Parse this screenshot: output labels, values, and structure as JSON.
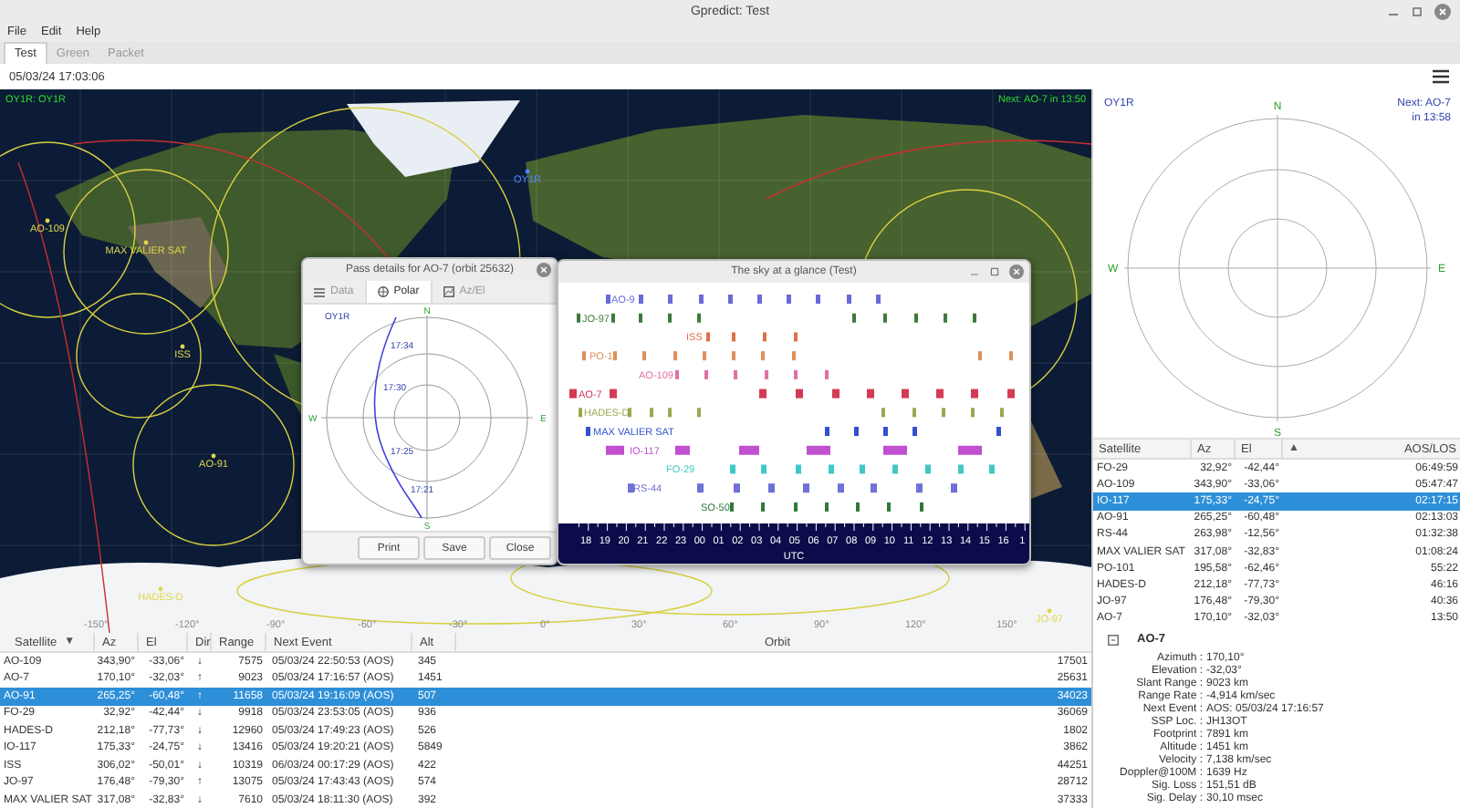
{
  "window": {
    "title": "Gpredict: Test"
  },
  "menu": [
    "File",
    "Edit",
    "Help"
  ],
  "tabs": [
    {
      "label": "Test",
      "selected": true
    },
    {
      "label": "Green",
      "selected": false
    },
    {
      "label": "Packet",
      "selected": false
    }
  ],
  "clock": "05/03/24 17:03:06",
  "map": {
    "qth_label": "OY1R: OY1R",
    "next_event": "Next: AO-7 in 13:50",
    "markers": [
      {
        "name": "OY1R",
        "kind": "station"
      },
      {
        "name": "AO-109",
        "kind": "satellite"
      },
      {
        "name": "MAX VALIER SAT",
        "kind": "satellite"
      },
      {
        "name": "ISS",
        "kind": "satellite"
      },
      {
        "name": "AO-91",
        "kind": "satellite"
      },
      {
        "name": "HADES-D",
        "kind": "satellite"
      },
      {
        "name": "JO-97",
        "kind": "satellite"
      }
    ],
    "longitudes": [
      "-150°",
      "-120°",
      "-90°",
      "-60°",
      "-30°",
      "0°",
      "30°",
      "60°",
      "90°",
      "120°",
      "150°"
    ]
  },
  "pass_dialog": {
    "title": "Pass details for AO-7 (orbit 25632)",
    "tabs": [
      {
        "label": "Data",
        "selected": false
      },
      {
        "label": "Polar",
        "selected": true
      },
      {
        "label": "Az/El",
        "selected": false
      }
    ],
    "station": "OY1R",
    "north": "N",
    "east": "E",
    "south": "S",
    "west": "W",
    "times": [
      "17:34",
      "17:30",
      "17:25",
      "17:21"
    ],
    "buttons": [
      "Print",
      "Save",
      "Close"
    ]
  },
  "sky_dialog": {
    "title": "The sky at a glance (Test)",
    "rows": [
      {
        "label": "AO-9",
        "color": "#6a6ad8"
      },
      {
        "label": "JO-97",
        "color": "#3d7a3d"
      },
      {
        "label": "ISS",
        "color": "#e0704a"
      },
      {
        "label": "PO-1",
        "color": "#e0905a"
      },
      {
        "label": "AO-109",
        "color": "#e070a8"
      },
      {
        "label": "AO-7",
        "color": "#d23a55"
      },
      {
        "label": "HADES-D",
        "color": "#98a850"
      },
      {
        "label": "MAX VALIER SAT",
        "color": "#3050d0"
      },
      {
        "label": "IO-117",
        "color": "#c050d0"
      },
      {
        "label": "FO-29",
        "color": "#40c8c8"
      },
      {
        "label": "RS-44",
        "color": "#7070d8"
      },
      {
        "label": "SO-50",
        "color": "#2f7a3a"
      }
    ],
    "hours": [
      "18",
      "19",
      "20",
      "21",
      "22",
      "23",
      "00",
      "01",
      "02",
      "03",
      "04",
      "05",
      "06",
      "07",
      "08",
      "09",
      "10",
      "11",
      "12",
      "13",
      "14",
      "15",
      "16",
      "1"
    ],
    "axis_label": "UTC"
  },
  "table": {
    "columns": [
      {
        "label": "Satellite",
        "sort_mark": "▼"
      },
      {
        "label": "Az"
      },
      {
        "label": "El"
      },
      {
        "label": "Dir"
      },
      {
        "label": "Range"
      },
      {
        "label": "Next Event"
      },
      {
        "label": "Alt"
      },
      {
        "label": "Orbit"
      }
    ],
    "rows": [
      {
        "cells": [
          "AO-109",
          "343,90°",
          "-33,06°",
          "↓",
          "7575",
          "05/03/24 22:50:53 (AOS)",
          "345",
          "17501"
        ],
        "selected": false
      },
      {
        "cells": [
          "AO-7",
          "170,10°",
          "-32,03°",
          "↑",
          "9023",
          "05/03/24 17:16:57 (AOS)",
          "1451",
          "25631"
        ],
        "selected": false
      },
      {
        "cells": [
          "AO-91",
          "265,25°",
          "-60,48°",
          "↑",
          "11658",
          "05/03/24 19:16:09 (AOS)",
          "507",
          "34023"
        ],
        "selected": true
      },
      {
        "cells": [
          "FO-29",
          "32,92°",
          "-42,44°",
          "↓",
          "9918",
          "05/03/24 23:53:05 (AOS)",
          "936",
          "36069"
        ],
        "selected": false
      },
      {
        "cells": [
          "HADES-D",
          "212,18°",
          "-77,73°",
          "↓",
          "12960",
          "05/03/24 17:49:23 (AOS)",
          "526",
          "1802"
        ],
        "selected": false
      },
      {
        "cells": [
          "IO-117",
          "175,33°",
          "-24,75°",
          "↓",
          "13416",
          "05/03/24 19:20:21 (AOS)",
          "5849",
          "3862"
        ],
        "selected": false
      },
      {
        "cells": [
          "ISS",
          "306,02°",
          "-50,01°",
          "↓",
          "10319",
          "06/03/24 00:17:29 (AOS)",
          "422",
          "44251"
        ],
        "selected": false
      },
      {
        "cells": [
          "JO-97",
          "176,48°",
          "-79,30°",
          "↑",
          "13075",
          "05/03/24 17:43:43 (AOS)",
          "574",
          "28712"
        ],
        "selected": false
      },
      {
        "cells": [
          "MAX VALIER SAT",
          "317,08°",
          "-32,83°",
          "↓",
          "7610",
          "05/03/24 18:11:30 (AOS)",
          "392",
          "37333"
        ],
        "selected": false
      }
    ]
  },
  "polar": {
    "station": "OY1R",
    "next_event": "Next: AO-7",
    "next_time": "in 13:58",
    "north": "N",
    "east": "E",
    "south": "S",
    "west": "W"
  },
  "side_table": {
    "columns": [
      {
        "label": "Satellite"
      },
      {
        "label": "Az"
      },
      {
        "label": "El"
      },
      {
        "label": "AOS/LOS",
        "sort_mark": "▲"
      }
    ],
    "rows": [
      {
        "cells": [
          "FO-29",
          "32,92°",
          "-42,44°",
          "06:49:59"
        ],
        "selected": false
      },
      {
        "cells": [
          "AO-109",
          "343,90°",
          "-33,06°",
          "05:47:47"
        ],
        "selected": false
      },
      {
        "cells": [
          "IO-117",
          "175,33°",
          "-24,75°",
          "02:17:15"
        ],
        "selected": true
      },
      {
        "cells": [
          "AO-91",
          "265,25°",
          "-60,48°",
          "02:13:03"
        ],
        "selected": false
      },
      {
        "cells": [
          "RS-44",
          "263,98°",
          "-12,56°",
          "01:32:38"
        ],
        "selected": false
      },
      {
        "cells": [
          "MAX VALIER SAT",
          "317,08°",
          "-32,83°",
          "01:08:24"
        ],
        "selected": false
      },
      {
        "cells": [
          "PO-101",
          "195,58°",
          "-62,46°",
          "55:22"
        ],
        "selected": false
      },
      {
        "cells": [
          "HADES-D",
          "212,18°",
          "-77,73°",
          "46:16"
        ],
        "selected": false
      },
      {
        "cells": [
          "JO-97",
          "176,48°",
          "-79,30°",
          "40:36"
        ],
        "selected": false
      },
      {
        "cells": [
          "AO-7",
          "170,10°",
          "-32,03°",
          "13:50"
        ],
        "selected": false
      }
    ]
  },
  "details": {
    "title": "AO-7",
    "fields": [
      {
        "label": "Azimuth :",
        "value": "170,10°"
      },
      {
        "label": "Elevation :",
        "value": "-32,03°"
      },
      {
        "label": "Slant Range :",
        "value": "9023 km"
      },
      {
        "label": "Range Rate :",
        "value": "-4,914 km/sec"
      },
      {
        "label": "Next Event :",
        "value": "AOS: 05/03/24 17:16:57"
      },
      {
        "label": "SSP Loc. :",
        "value": "JH13OT"
      },
      {
        "label": "Footprint :",
        "value": "7891 km"
      },
      {
        "label": "Altitude :",
        "value": "1451 km"
      },
      {
        "label": "Velocity :",
        "value": "7,138 km/sec"
      },
      {
        "label": "Doppler@100M :",
        "value": "1639 Hz"
      },
      {
        "label": "Sig. Loss :",
        "value": "151,51 dB"
      },
      {
        "label": "Sig. Delay :",
        "value": "30,10 msec"
      }
    ]
  }
}
